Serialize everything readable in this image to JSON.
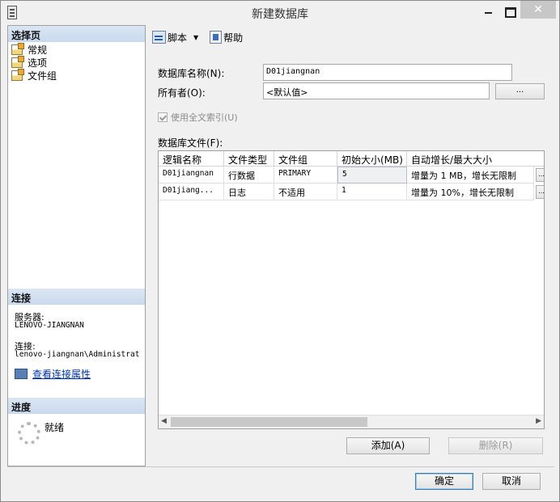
{
  "window": {
    "title": "新建数据库",
    "close_glyph": "✕"
  },
  "left": {
    "select_page_header": "选择页",
    "pages": [
      {
        "label": "常规"
      },
      {
        "label": "选项"
      },
      {
        "label": "文件组"
      }
    ],
    "connection_header": "连接",
    "server_label": "服务器:",
    "server_value": "LENOVO-JIANGNAN",
    "connection_label": "连接:",
    "connection_value": "lenovo-jiangnan\\Administrat",
    "view_connection_link": "查看连接属性",
    "progress_header": "进度",
    "status": "就绪"
  },
  "toolbar": {
    "script_label": "脚本",
    "dropdown_glyph": "▼",
    "help_label": "帮助"
  },
  "form": {
    "db_name_label": "数据库名称(N):",
    "db_name_value": "D01jiangnan",
    "owner_label": "所有者(O):",
    "owner_value": "<默认值>",
    "owner_browse": "...",
    "fulltext_label": "使用全文索引(U)",
    "files_label": "数据库文件(F):"
  },
  "files_grid": {
    "columns": [
      "逻辑名称",
      "文件类型",
      "文件组",
      "初始大小(MB)",
      "自动增长/最大大小"
    ],
    "rows": [
      {
        "logical": "D01jiangnan",
        "type": "行数据",
        "filegroup": "PRIMARY",
        "size": "5",
        "growth": "增量为 1 MB，增长无限制",
        "btn": "..."
      },
      {
        "logical": "D01jiang...",
        "type": "日志",
        "filegroup": "不适用",
        "size": "1",
        "growth": "增量为 10%，增长无限制",
        "btn": "..."
      }
    ],
    "scroll_left": "◀",
    "scroll_right": "▶"
  },
  "buttons": {
    "add": "添加(A)",
    "remove": "删除(R)",
    "ok": "确定",
    "cancel": "取消"
  }
}
